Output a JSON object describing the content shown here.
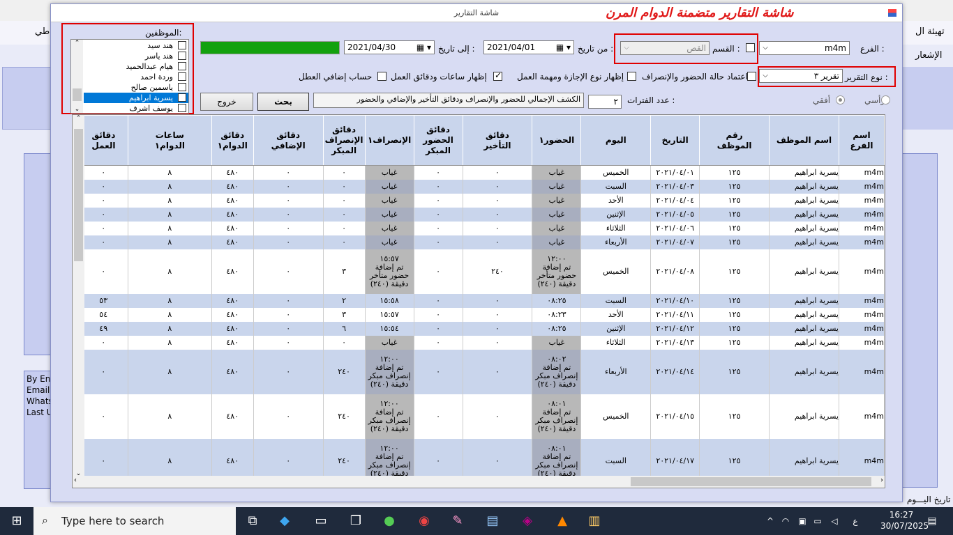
{
  "background": {
    "left_text": "طي",
    "right_text1": "تهيئة ال",
    "right_text2": "الإشعار",
    "left_box_lines": [
      "By Eng",
      "Email",
      "Whats",
      "Last U"
    ],
    "bottom_text": "تاريخ اليـــوم"
  },
  "window": {
    "title": "شاشة التقارير",
    "banner": "شاشة التقارير متضمنة الدوام المرن"
  },
  "filters": {
    "branch_label": "الفرع :",
    "branch_value": "m4m",
    "dept_label": "القسم :",
    "dept_value": "القص",
    "from_label": "من تاريخ :",
    "from_value": "2021/04/01",
    "to_label": "إلى تاريخ :",
    "to_value": "2021/04/30",
    "employees_label": "الموظفين:",
    "report_type_label": "نوع التقرير :",
    "report_type_value": "تقرير ٣",
    "opt_attendance_status": "اعتماد حالة الحضور والإنصراف",
    "opt_leave_type": "إظهار نوع الإجازة ومهمة العمل",
    "opt_work_hours": "إظهار ساعات ودقائق العمل",
    "opt_extra_holiday": "حساب إضافي العطل",
    "periods_label": "عدد الفترات :",
    "periods_value": "٢",
    "report_desc": "الكشف الإجمالي للحضور والإنصراف ودقائق التأخير والإضافي والحضور",
    "orientation_vertical": "رأسي",
    "orientation_horizontal": "أفقي",
    "progress_fraction": 1.0,
    "progress_color": "#13a10e"
  },
  "buttons": {
    "search": "بحث",
    "exit": "خروج"
  },
  "employees": [
    {
      "name": "هند سيد",
      "checked": false,
      "selected": false
    },
    {
      "name": "هند ياسر",
      "checked": false,
      "selected": false
    },
    {
      "name": "هيام عبدالحميد",
      "checked": false,
      "selected": false
    },
    {
      "name": "وردة احمد",
      "checked": false,
      "selected": false
    },
    {
      "name": "ياسمين صالح",
      "checked": false,
      "selected": false
    },
    {
      "name": "يسرية ابراهيم",
      "checked": true,
      "selected": true
    },
    {
      "name": "يوسف اشرف",
      "checked": false,
      "selected": false
    }
  ],
  "table": {
    "columns": [
      "اسم\nالفرع",
      "اسم الموظف",
      "رقم\nالموظف",
      "التاريخ",
      "اليوم",
      "الحضور١",
      "دقائق\nالتأخير",
      "دقائق\nالحضور\nالمبكر",
      "الإنصراف١",
      "دقائق\nالإنصراف\nالمبكر",
      "دقائق\nالإضافي",
      "دقائق\nالدوام١",
      "ساعات\nالدوام١",
      "دقائق\nالعمل"
    ],
    "rows": [
      [
        "m4m",
        "يسرية ابراهيم",
        "١٢٥",
        "٢٠٢١/٠٤/٠١",
        "الخميس",
        "غياب",
        "٠",
        "٠",
        "غياب",
        "٠",
        "٠",
        "٤٨٠",
        "٨",
        "٠"
      ],
      [
        "m4m",
        "يسرية ابراهيم",
        "١٢٥",
        "٢٠٢١/٠٤/٠٣",
        "السبت",
        "غياب",
        "٠",
        "٠",
        "غياب",
        "٠",
        "٠",
        "٤٨٠",
        "٨",
        "٠"
      ],
      [
        "m4m",
        "يسرية ابراهيم",
        "١٢٥",
        "٢٠٢١/٠٤/٠٤",
        "الأحد",
        "غياب",
        "٠",
        "٠",
        "غياب",
        "٠",
        "٠",
        "٤٨٠",
        "٨",
        "٠"
      ],
      [
        "m4m",
        "يسرية ابراهيم",
        "١٢٥",
        "٢٠٢١/٠٤/٠٥",
        "الإثنين",
        "غياب",
        "٠",
        "٠",
        "غياب",
        "٠",
        "٠",
        "٤٨٠",
        "٨",
        "٠"
      ],
      [
        "m4m",
        "يسرية ابراهيم",
        "١٢٥",
        "٢٠٢١/٠٤/٠٦",
        "الثلاثاء",
        "غياب",
        "٠",
        "٠",
        "غياب",
        "٠",
        "٠",
        "٤٨٠",
        "٨",
        "٠"
      ],
      [
        "m4m",
        "يسرية ابراهيم",
        "١٢٥",
        "٢٠٢١/٠٤/٠٧",
        "الأربعاء",
        "غياب",
        "٠",
        "٠",
        "غياب",
        "٠",
        "٠",
        "٤٨٠",
        "٨",
        "٠"
      ],
      [
        "m4m",
        "يسرية ابراهيم",
        "١٢٥",
        "٢٠٢١/٠٤/٠٨",
        "الخميس",
        "١٢:٠٠\nتم إضافة\nحضور متأخر\n(٢٤٠) دقيقة",
        "٢٤٠",
        "٠",
        "١٥:٥٧\nتم إضافة\nحضور متأخر\n(٢٤٠) دقيقة",
        "٣",
        "٠",
        "٤٨٠",
        "٨",
        "٠"
      ],
      [
        "m4m",
        "يسرية ابراهيم",
        "١٢٥",
        "٢٠٢١/٠٤/١٠",
        "السبت",
        "٠٨:٢٥",
        "٠",
        "٠",
        "١٥:٥٨",
        "٢",
        "٠",
        "٤٨٠",
        "٨",
        "٥٣"
      ],
      [
        "m4m",
        "يسرية ابراهيم",
        "١٢٥",
        "٢٠٢١/٠٤/١١",
        "الأحد",
        "٠٨:٢٣",
        "٠",
        "٠",
        "١٥:٥٧",
        "٣",
        "٠",
        "٤٨٠",
        "٨",
        "٥٤"
      ],
      [
        "m4m",
        "يسرية ابراهيم",
        "١٢٥",
        "٢٠٢١/٠٤/١٢",
        "الإثنين",
        "٠٨:٢٥",
        "٠",
        "٠",
        "١٥:٥٤",
        "٦",
        "٠",
        "٤٨٠",
        "٨",
        "٤٩"
      ],
      [
        "m4m",
        "يسرية ابراهيم",
        "١٢٥",
        "٢٠٢١/٠٤/١٣",
        "الثلاثاء",
        "غياب",
        "٠",
        "٠",
        "غياب",
        "٠",
        "٠",
        "٤٨٠",
        "٨",
        "٠"
      ],
      [
        "m4m",
        "يسرية ابراهيم",
        "١٢٥",
        "٢٠٢١/٠٤/١٤",
        "الأربعاء",
        "٠٨:٠٢\nتم إضافة\nإنصراف مبكر\n(٢٤٠) دقيقة",
        "٠",
        "٠",
        "١٢:٠٠\nتم إضافة\nإنصراف مبكر\n(٢٤٠) دقيقة",
        "٢٤٠",
        "٠",
        "٤٨٠",
        "٨",
        "٠"
      ],
      [
        "m4m",
        "يسرية ابراهيم",
        "١٢٥",
        "٢٠٢١/٠٤/١٥",
        "الخميس",
        "٠٨:٠١\nتم إضافة\nإنصراف مبكر\n(٢٤٠) دقيقة",
        "٠",
        "٠",
        "١٢:٠٠\nتم إضافة\nإنصراف مبكر\n(٢٤٠) دقيقة",
        "٢٤٠",
        "٠",
        "٤٨٠",
        "٨",
        "٠"
      ],
      [
        "m4m",
        "يسرية ابراهيم",
        "١٢٥",
        "٢٠٢١/٠٤/١٧",
        "السبت",
        "٠٨:٠١\nتم إضافة\nإنصراف مبكر\n(٢٤٠) دقيقة",
        "٠",
        "٠",
        "١٢:٠٠\nتم إضافة\nإنصراف مبكر\n(٢٤٠) دقيقة",
        "٢٤٠",
        "٠",
        "٤٨٠",
        "٨",
        "٠"
      ]
    ]
  },
  "taskbar": {
    "search_placeholder": "Type here to search",
    "time": "16:27",
    "date": "30/07/2025",
    "lang": "ع"
  }
}
